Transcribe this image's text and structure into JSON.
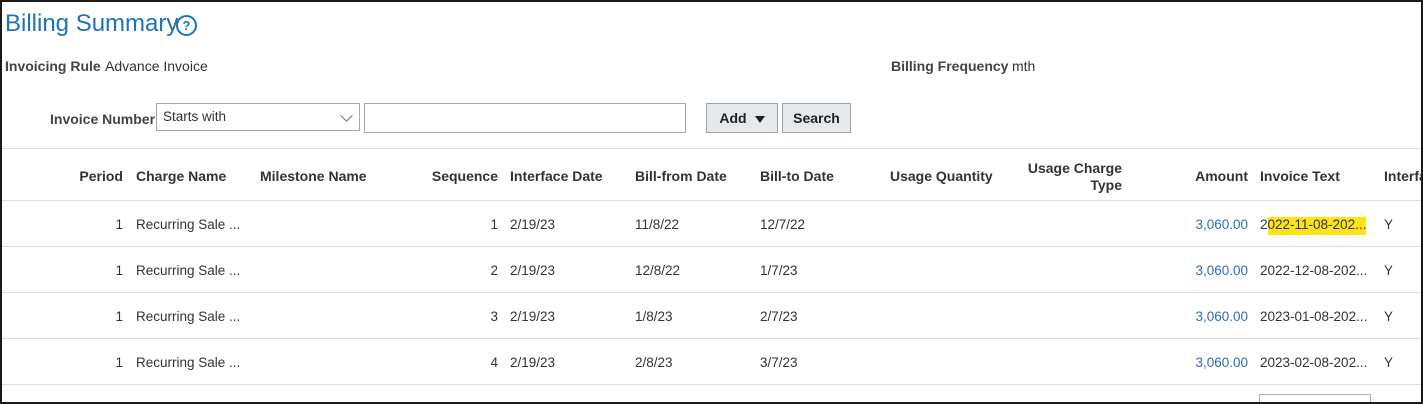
{
  "header": {
    "title": "Billing Summary",
    "help_icon": "question-circle-icon"
  },
  "info": {
    "invoicing_rule_label": "Invoicing Rule",
    "invoicing_rule_value": "Advance Invoice",
    "billing_frequency_label": "Billing Frequency",
    "billing_frequency_value": "mth"
  },
  "search": {
    "field_label": "Invoice Number",
    "operator_value": "Starts with",
    "input_value": "",
    "add_label": "Add",
    "search_label": "Search"
  },
  "table": {
    "columns": {
      "period": "Period",
      "charge_name": "Charge Name",
      "milestone_name": "Milestone Name",
      "sequence": "Sequence",
      "interface_date": "Interface Date",
      "bill_from": "Bill-from Date",
      "bill_to": "Bill-to Date",
      "usage_quantity": "Usage Quantity",
      "usage_charge_type_1": "Usage Charge",
      "usage_charge_type_2": "Type",
      "amount": "Amount",
      "invoice_text": "Invoice Text",
      "interfaced": "Interfa"
    },
    "rows": [
      {
        "period": "1",
        "charge_name": "Recurring Sale ...",
        "milestone_name": "",
        "sequence": "1",
        "interface_date": "2/19/23",
        "bill_from": "11/8/22",
        "bill_to": "12/7/22",
        "usage_quantity": "",
        "usage_charge_type": "",
        "amount": "3,060.00",
        "invoice_text_prefix": "2",
        "invoice_text_highlight": "022-11-08-202...",
        "invoice_text": "",
        "interfaced": "Y"
      },
      {
        "period": "1",
        "charge_name": "Recurring Sale ...",
        "milestone_name": "",
        "sequence": "2",
        "interface_date": "2/19/23",
        "bill_from": "12/8/22",
        "bill_to": "1/7/23",
        "usage_quantity": "",
        "usage_charge_type": "",
        "amount": "3,060.00",
        "invoice_text": "2022-12-08-202...",
        "interfaced": "Y"
      },
      {
        "period": "1",
        "charge_name": "Recurring Sale ...",
        "milestone_name": "",
        "sequence": "3",
        "interface_date": "2/19/23",
        "bill_from": "1/8/23",
        "bill_to": "2/7/23",
        "usage_quantity": "",
        "usage_charge_type": "",
        "amount": "3,060.00",
        "invoice_text": "2023-01-08-202...",
        "interfaced": "Y"
      },
      {
        "period": "1",
        "charge_name": "Recurring Sale ...",
        "milestone_name": "",
        "sequence": "4",
        "interface_date": "2/19/23",
        "bill_from": "2/8/23",
        "bill_to": "3/7/23",
        "usage_quantity": "",
        "usage_charge_type": "",
        "amount": "3,060.00",
        "invoice_text": "2023-02-08-202...",
        "interfaced": "Y"
      }
    ]
  },
  "colors": {
    "title": "#1b73b9",
    "link": "#2f6bbf",
    "highlight": "#ffe31a"
  }
}
